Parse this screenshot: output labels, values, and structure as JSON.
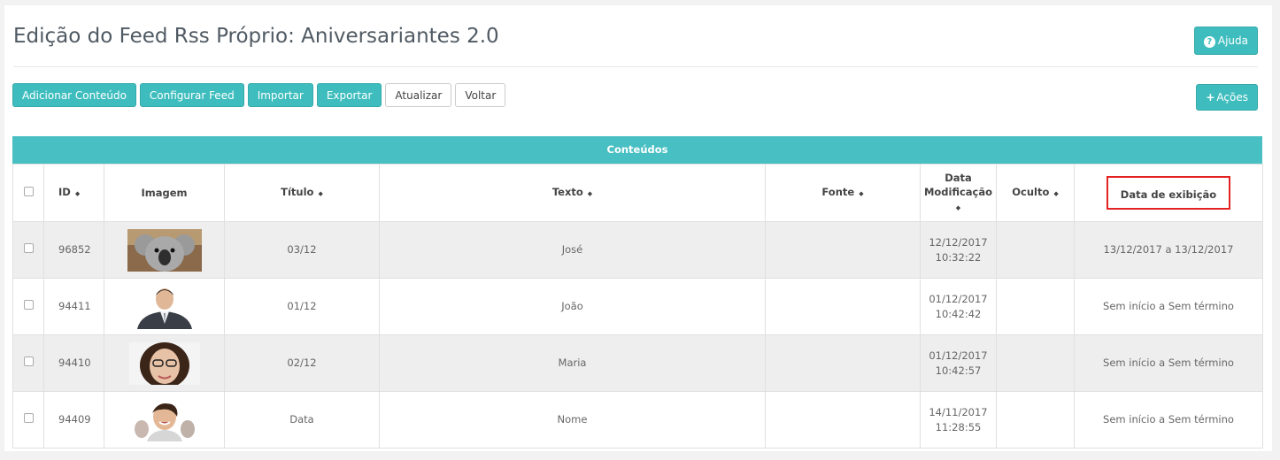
{
  "page": {
    "title": "Edição do Feed Rss Próprio: Aniversariantes 2.0"
  },
  "header": {
    "help_label": "Ajuda",
    "help_icon": "question-circle-icon"
  },
  "toolbar": {
    "add_label": "Adicionar Conteúdo",
    "configure_label": "Configurar Feed",
    "import_label": "Importar",
    "export_label": "Exportar",
    "refresh_label": "Atualizar",
    "back_label": "Voltar",
    "actions_label": "Ações",
    "actions_icon": "plus-icon"
  },
  "table": {
    "caption": "Conteúdos",
    "columns": {
      "id": "ID",
      "image": "Imagem",
      "title": "Título",
      "text": "Texto",
      "source": "Fonte",
      "modified_1": "Data",
      "modified_2": "Modificação",
      "hidden": "Oculto",
      "display_date": "Data de exibição"
    },
    "rows": [
      {
        "id": "96852",
        "title": "03/12",
        "text": "José",
        "source": "",
        "mod_date": "12/12/2017",
        "mod_time": "10:32:22",
        "hidden": "",
        "display": "13/12/2017 a 13/12/2017",
        "image": "koala-photo"
      },
      {
        "id": "94411",
        "title": "01/12",
        "text": "João",
        "source": "",
        "mod_date": "01/12/2017",
        "mod_time": "10:42:42",
        "hidden": "",
        "display": "Sem início a Sem término",
        "image": "businessman-photo"
      },
      {
        "id": "94410",
        "title": "02/12",
        "text": "Maria",
        "source": "",
        "mod_date": "01/12/2017",
        "mod_time": "10:42:57",
        "hidden": "",
        "display": "Sem início a Sem término",
        "image": "woman-glasses-photo"
      },
      {
        "id": "94409",
        "title": "Data",
        "text": "Nome",
        "source": "",
        "mod_date": "14/11/2017",
        "mod_time": "11:28:55",
        "hidden": "",
        "display": "Sem início a Sem término",
        "image": "smiling-woman-photo"
      }
    ]
  },
  "colors": {
    "accent": "#3fbdbe",
    "header_bar": "#48bfc2",
    "highlight": "#e32222"
  }
}
